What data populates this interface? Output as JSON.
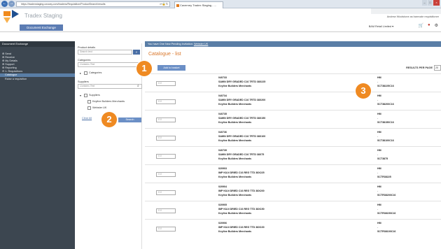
{
  "browser": {
    "url": "https://tradexstaging.cwuvsy.com/tradexs/Requisition/ProductSearch/results",
    "tab_title": "Caverney Tradex Staging - ..."
  },
  "header": {
    "brand_title": "Tradex Staging",
    "doc_tab": "Document Exchange",
    "user_name": "Andrew Woolstone as barnvale requisitioner",
    "account": "BAM Retail Limited ▾"
  },
  "sidebar": {
    "title": "Document Exchange",
    "items": [
      {
        "label": "⊕ Send"
      },
      {
        "label": "⊕ Receive"
      },
      {
        "label": "⊕ My Details"
      },
      {
        "label": "⊕ Support"
      },
      {
        "label": "⊕ Reporting"
      },
      {
        "label": "⊖ 1. Requisitions"
      },
      {
        "label": "Catalogue"
      },
      {
        "label": "Raise a requisition"
      }
    ]
  },
  "filters": {
    "product_details_label": "Product details",
    "search_placeholder": "Search text",
    "categories_label": "Categories",
    "categories_value": "Contains Text",
    "categories_tree": "Categories",
    "suppliers_label": "Suppliers",
    "suppliers_value": "Contains Text",
    "suppliers_tree": "Suppliers",
    "supplier_options": [
      "Keyline Builders Merchants",
      "Webster UK"
    ],
    "clear_label": "Clear All",
    "search_button": "Search"
  },
  "main": {
    "notice": "You have One New Pending Invitation:",
    "notice_link": "Webster UK",
    "page_title": "Catalogue - list",
    "add_to_basket": "Add to basket",
    "results_per_page_label": "RESULTS PER PAGE",
    "results_per_page_value": "20",
    "qty_placeholder": "0.0",
    "rows": [
      {
        "code": "040733",
        "desc": "SAWN DRY GRADED C16 TRTD 38X225",
        "supplier": "Keyline Builders Merchants",
        "unit": "HM",
        "dash": "-",
        "sup_code": "SCT38225C16"
      },
      {
        "code": "040734",
        "desc": "SAWN DRY GRADED C16 TRTD 38X200",
        "supplier": "Keyline Builders Merchants",
        "unit": "HM",
        "dash": "-",
        "sup_code": "SCT38200C16"
      },
      {
        "code": "040735",
        "desc": "SAWN DRY GRADED C16 TRTD 38X150",
        "supplier": "Keyline Builders Merchants",
        "unit": "HM",
        "dash": "-",
        "sup_code": "SCT38150C16"
      },
      {
        "code": "040736",
        "desc": "SAWN DRY GRADED C16 TRTD 38X100",
        "supplier": "Keyline Builders Merchants",
        "unit": "HM",
        "dash": "-",
        "sup_code": "SCT38100C16"
      },
      {
        "code": "040739",
        "desc": "SAWN DRY GRADED C16 TRTD 38X75",
        "supplier": "Keyline Builders Merchants",
        "unit": "HM",
        "dash": "-",
        "sup_code": "SCT3875"
      },
      {
        "code": "020903",
        "desc": "IMP KILN DRIED C16 REG TTD 38X225",
        "supplier": "Keyline Builders Merchants",
        "unit": "HM",
        "dash": "-",
        "sup_code": "SCTR38225"
      },
      {
        "code": "020904",
        "desc": "IMP KILN DRIED C16 REG TTD 38X200",
        "supplier": "Keyline Builders Merchants",
        "unit": "HM",
        "dash": "-",
        "sup_code": "SCTR38200C16"
      },
      {
        "code": "020905",
        "desc": "IMP KILN DRIED C16 REG TTD 38X150",
        "supplier": "Keyline Builders Merchants",
        "unit": "HM",
        "dash": "-",
        "sup_code": "SCTR38150C16"
      },
      {
        "code": "020906",
        "desc": "IMP KILN DRIED C16 REG TTD 38X100",
        "supplier": "Keyline Builders Merchants",
        "unit": "HM",
        "dash": "-",
        "sup_code": "SCTR38100C16"
      }
    ]
  },
  "callouts": [
    "1",
    "2",
    "3"
  ],
  "colors": {
    "accent": "#d9772b",
    "callout": "#ef8a22",
    "primary_button": "#6b8fc6",
    "sidebar_bg": "#3c4650",
    "notice_bg": "#5a7ea6"
  }
}
